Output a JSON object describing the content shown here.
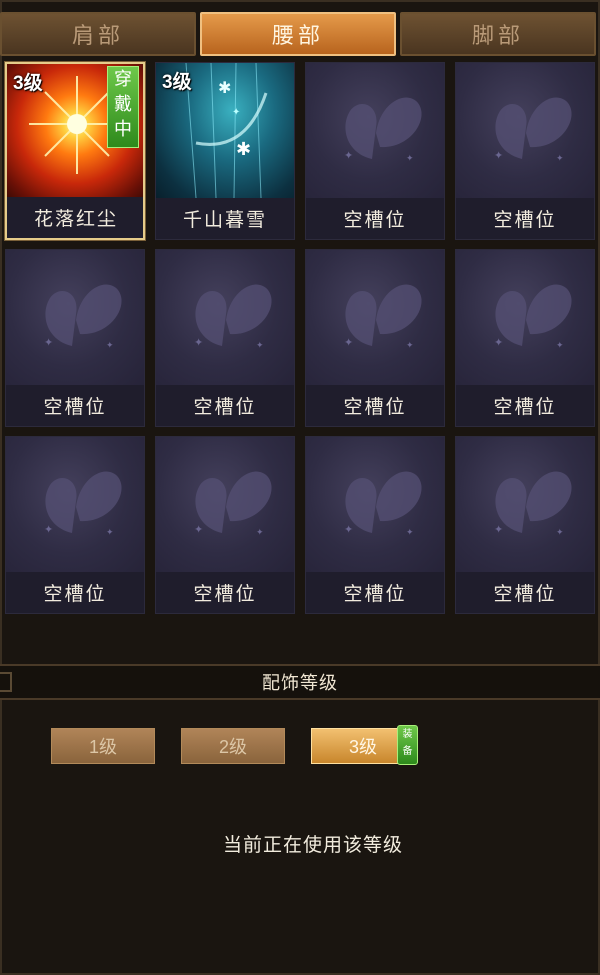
{
  "tabs": [
    {
      "label": "肩部",
      "active": false
    },
    {
      "label": "腰部",
      "active": true
    },
    {
      "label": "脚部",
      "active": false
    }
  ],
  "slots": [
    {
      "name": "花落红尘",
      "level": "3级",
      "badge": "穿戴中",
      "state": "equipped"
    },
    {
      "name": "千山暮雪",
      "level": "3级",
      "state": "owned"
    },
    {
      "name": "空槽位",
      "state": "empty"
    },
    {
      "name": "空槽位",
      "state": "empty"
    },
    {
      "name": "空槽位",
      "state": "empty"
    },
    {
      "name": "空槽位",
      "state": "empty"
    },
    {
      "name": "空槽位",
      "state": "empty"
    },
    {
      "name": "空槽位",
      "state": "empty"
    },
    {
      "name": "空槽位",
      "state": "empty"
    },
    {
      "name": "空槽位",
      "state": "empty"
    },
    {
      "name": "空槽位",
      "state": "empty"
    },
    {
      "name": "空槽位",
      "state": "empty"
    }
  ],
  "section_title": "配饰等级",
  "levels": [
    {
      "label": "1级",
      "active": false
    },
    {
      "label": "2级",
      "active": false
    },
    {
      "label": "3级",
      "active": true,
      "tag": "装备"
    }
  ],
  "status_text": "当前正在使用该等级",
  "icons": {
    "empty_slot": "butterfly-icon"
  },
  "colors": {
    "tab_active": "#d9883a",
    "badge_green": "#3fa42a",
    "slot_bg": "#2a2838"
  }
}
